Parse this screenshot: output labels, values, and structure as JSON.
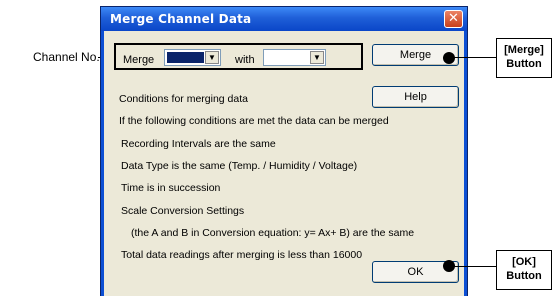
{
  "dialog": {
    "title": "Merge Channel Data",
    "close_glyph": "✕"
  },
  "merge_row": {
    "merge_label": "Merge",
    "with_label": "with",
    "dropdown_arrow": "▼"
  },
  "buttons": {
    "merge": "Merge",
    "help": "Help",
    "ok": "OK"
  },
  "conditions": [
    "Conditions for merging data",
    "If the following conditions are met the data can be merged",
    "Recording Intervals are the same",
    "Data Type is the same (Temp. / Humidity / Voltage)",
    "Time is in succession",
    "Scale Conversion Settings",
    "(the A and B in Conversion equation: y= Ax+ B) are the same",
    "Total data readings after merging is less than 16000"
  ],
  "callouts": {
    "channel_no": "Channel No.",
    "merge_button_line1": "[Merge]",
    "merge_button_line2": "Button",
    "ok_button_line1": "[OK]",
    "ok_button_line2": "Button"
  },
  "colors": {
    "titlebar": "#0a46c8",
    "dialog_bg": "#ece9d8",
    "close_button": "#c8401b",
    "selected_combo": "#0a246a"
  },
  "icons": [
    "close-icon",
    "dropdown-arrow-icon"
  ]
}
